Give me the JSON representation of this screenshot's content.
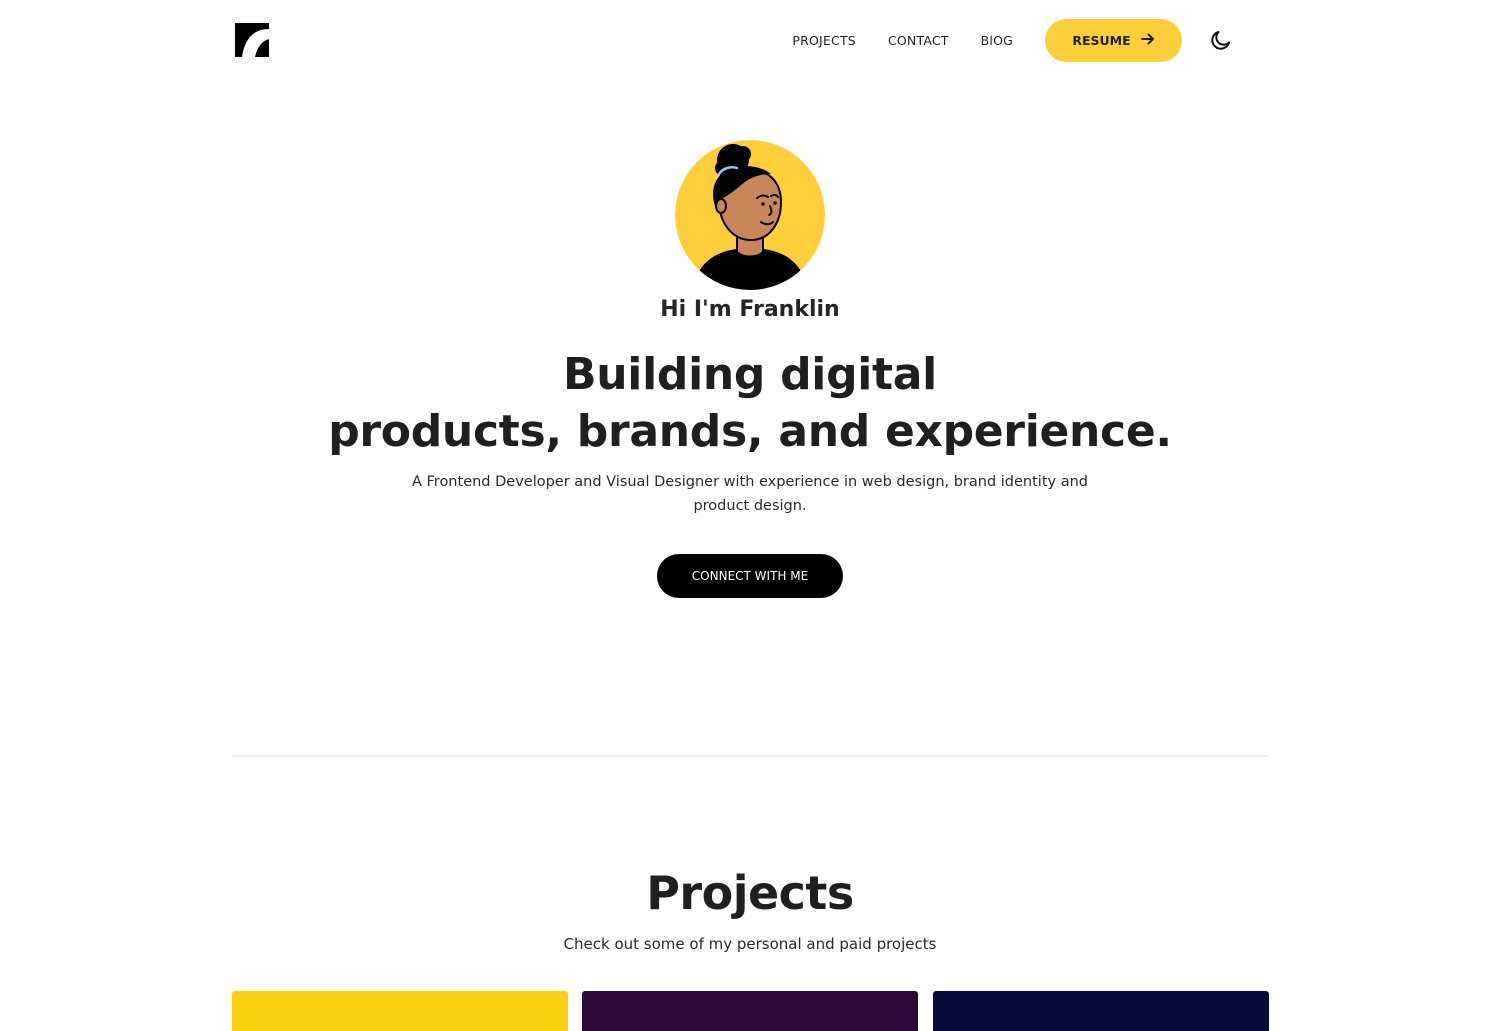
{
  "colors": {
    "accent": "#FFCE3A",
    "text_dark": "#1f1f1f",
    "button_dark": "#000000",
    "skin": "#C9865A",
    "divider": "#eeeeee"
  },
  "header": {
    "logo_icon": "brand-logo-icon",
    "nav": {
      "projects": "PROJECTS",
      "contact": "CONTACT",
      "blog": "BlOG"
    },
    "resume_label": "RESUME",
    "resume_icon": "arrow-right-icon",
    "theme_icon": "moon-icon"
  },
  "hero": {
    "greeting": "Hi I'm Franklin",
    "headline_line1": "Building digital",
    "headline_line2": "products, brands, and experience.",
    "subtitle": "A Frontend Developer and Visual Designer with experience in web design, brand identity and product design.",
    "cta_label": "CONNECT WITH ME"
  },
  "projects": {
    "title": "Projects",
    "subtitle": "Check out some of my personal and paid projects",
    "cards": [
      {
        "color": "#F9D30F"
      },
      {
        "color": "#2B0A3A"
      },
      {
        "color": "#0B0B3B"
      }
    ]
  }
}
